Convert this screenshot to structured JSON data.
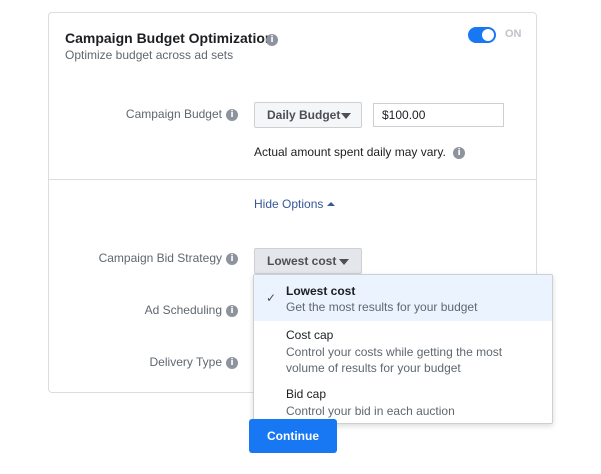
{
  "header": {
    "title": "Campaign Budget Optimization",
    "subtitle": "Optimize budget across ad sets",
    "toggle_label": "ON",
    "toggle_on": true
  },
  "budget": {
    "label": "Campaign Budget",
    "type_label": "Daily Budget",
    "amount": "$100.00",
    "note": "Actual amount spent daily may vary."
  },
  "hide_options": "Hide Options",
  "bid_strategy": {
    "label": "Campaign Bid Strategy",
    "selected": "Lowest cost"
  },
  "ad_scheduling": {
    "label": "Ad Scheduling"
  },
  "delivery_type": {
    "label": "Delivery Type"
  },
  "dropdown": {
    "options": [
      {
        "title": "Lowest cost",
        "desc": "Get the most results for your budget",
        "selected": true
      },
      {
        "title": "Cost cap",
        "desc": "Control your costs while getting the most volume of results for your budget",
        "selected": false
      },
      {
        "title": "Bid cap",
        "desc": "Control your bid in each auction",
        "selected": false
      }
    ]
  },
  "continue_label": "Continue",
  "icons": {
    "info": "info-icon",
    "check": "checkmark-icon",
    "caret": "caret-down-icon"
  },
  "colors": {
    "accent": "#1877f2",
    "link": "#365899",
    "selected_bg": "#ebf3ff"
  }
}
